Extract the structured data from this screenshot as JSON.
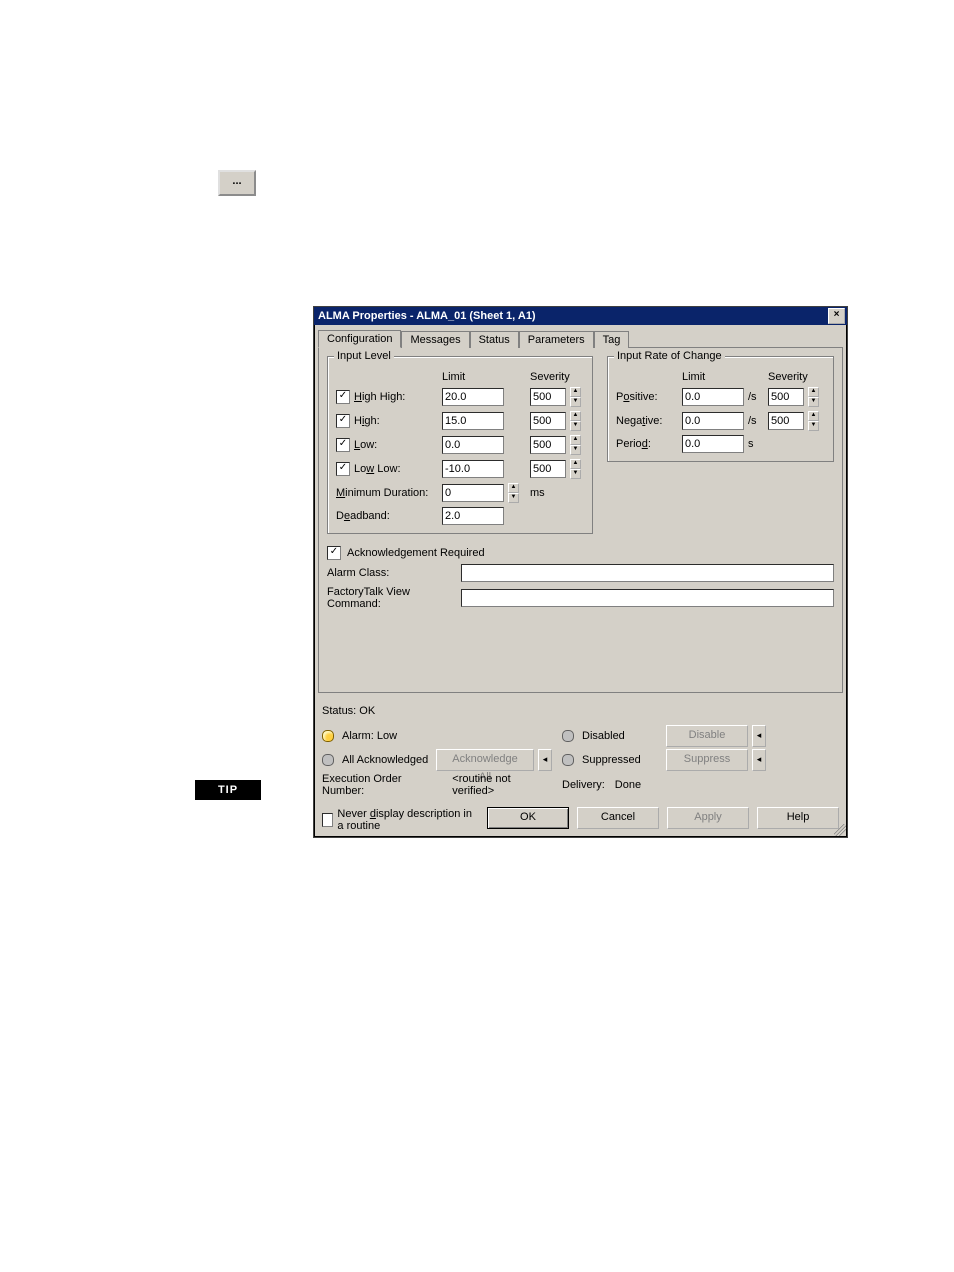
{
  "ellipsis_label": "...",
  "tip_badge": "TIP",
  "dialog": {
    "title": "ALMA Properties - ALMA_01 (Sheet 1, A1)",
    "tabs": {
      "configuration": "Configuration",
      "messages": "Messages",
      "status": "Status",
      "parameters": "Parameters",
      "tag": "Tag"
    },
    "input_level": {
      "legend": "Input Level",
      "limit_hdr": "Limit",
      "severity_hdr": "Severity",
      "high_high": {
        "label": "High High:",
        "limit": "20.0",
        "sev": "500"
      },
      "high": {
        "label": "High:",
        "limit": "15.0",
        "sev": "500"
      },
      "low": {
        "label": "Low:",
        "limit": "0.0",
        "sev": "500"
      },
      "low_low": {
        "label": "Low Low:",
        "limit": "-10.0",
        "sev": "500"
      },
      "min_dur": {
        "label": "Minimum Duration:",
        "value": "0",
        "unit": "ms"
      },
      "deadband": {
        "label": "Deadband:",
        "value": "2.0"
      }
    },
    "roc": {
      "legend": "Input Rate of Change",
      "limit_hdr": "Limit",
      "severity_hdr": "Severity",
      "positive": {
        "label": "Positive:",
        "limit": "0.0",
        "sev": "500",
        "unit": "/s"
      },
      "negative": {
        "label": "Negative:",
        "limit": "0.0",
        "sev": "500",
        "unit": "/s"
      },
      "period": {
        "label": "Period:",
        "value": "0.0",
        "unit": "s"
      }
    },
    "ack_req": "Acknowledgement Required",
    "alarm_class": "Alarm Class:",
    "ft_view_cmd": "FactoryTalk View Command:",
    "status_line": "Status:  OK",
    "alarm_state": "Alarm:  Low",
    "all_ack": "All Acknowledged",
    "ack_all_btn": "Acknowledge All",
    "disabled_lbl": "Disabled",
    "disable_btn": "Disable",
    "suppressed_lbl": "Suppressed",
    "suppress_btn": "Suppress",
    "exec_order": "Execution Order Number:",
    "exec_order_val": "<routine not verified>",
    "delivery": "Delivery:",
    "delivery_val": "Done",
    "never_display": "Never display description in a routine",
    "buttons": {
      "ok": "OK",
      "cancel": "Cancel",
      "apply": "Apply",
      "help": "Help"
    }
  }
}
